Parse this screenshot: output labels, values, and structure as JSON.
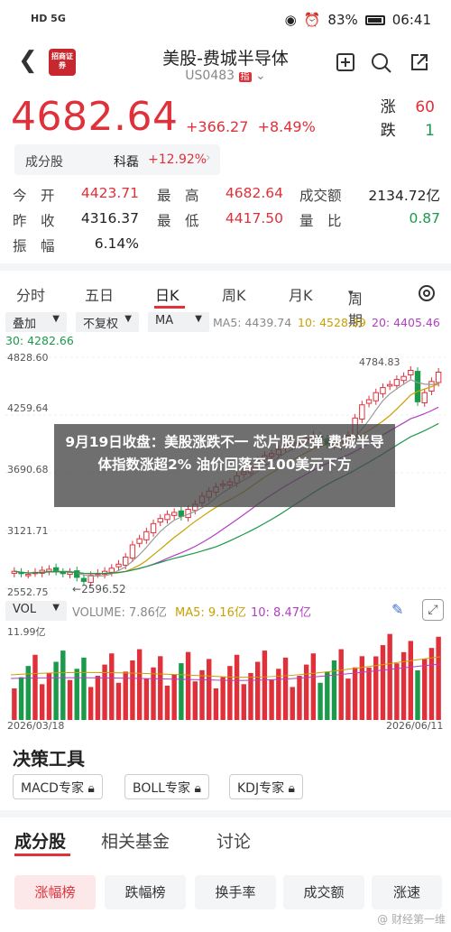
{
  "status": {
    "left": "HD 5G",
    "battery": "83%",
    "time": "06:41"
  },
  "header": {
    "logo_text": "招商证券",
    "title": "美股-费城半导体",
    "code": "US0483",
    "tag": "指"
  },
  "quote": {
    "price": "4682.64",
    "change": "+366.27",
    "pct": "+8.49%",
    "up_label": "涨",
    "up_count": "60",
    "down_label": "跌",
    "down_count": "1"
  },
  "sector": {
    "label": "成分股",
    "name": "科磊",
    "pct": "+12.92%"
  },
  "stats": [
    [
      {
        "k": "今　开",
        "v": "4423.71",
        "c": "red"
      },
      {
        "k": "最　高",
        "v": "4682.64",
        "c": "red"
      },
      {
        "k": "成交额",
        "v": "2134.72亿",
        "c": "dark"
      }
    ],
    [
      {
        "k": "昨　收",
        "v": "4316.37",
        "c": "dark"
      },
      {
        "k": "最　低",
        "v": "4417.50",
        "c": "red"
      },
      {
        "k": "量　比",
        "v": "0.87",
        "c": "green"
      }
    ],
    [
      {
        "k": "振　幅",
        "v": "6.14%",
        "c": "dark"
      }
    ]
  ],
  "tabs": [
    "分时",
    "五日",
    "日K",
    "周K",
    "月K",
    "周期"
  ],
  "controls": {
    "overlay": "叠加",
    "adjust": "不复权",
    "indicator": "MA"
  },
  "ma": {
    "ma5": "MA5: 4439.74",
    "ma10": "10: 4528.39",
    "ma20": "20: 4405.46",
    "ma30": "30: 4282.66"
  },
  "chart_data": {
    "type": "candlestick",
    "ylim": [
      2552.75,
      4828.6
    ],
    "y_ticks": [
      "4828.60",
      "4259.64",
      "3690.68",
      "3121.71",
      "2552.75"
    ],
    "annotations": {
      "high": "4784.83",
      "low": "2596.52"
    },
    "x_ticks": [
      "2026/03/18",
      "2026/06/11"
    ],
    "closes": [
      2720,
      2700,
      2690,
      2710,
      2730,
      2740,
      2720,
      2700,
      2710,
      2660,
      2620,
      2680,
      2700,
      2720,
      2750,
      2790,
      2860,
      2980,
      3040,
      3110,
      3190,
      3240,
      3280,
      3300,
      3260,
      3330,
      3380,
      3460,
      3510,
      3550,
      3580,
      3600,
      3660,
      3700,
      3750,
      3810,
      3860,
      3880,
      3920,
      3960,
      3990,
      4000,
      4030,
      4060,
      4010,
      3970,
      3960,
      3990,
      4060,
      4230,
      4360,
      4410,
      4480,
      4530,
      4560,
      4610,
      4640,
      4700,
      4390,
      4480,
      4590,
      4682
    ]
  },
  "volume": {
    "label": "VOL",
    "vol": "VOLUME: 7.86亿",
    "ma5": "MA5: 9.16亿",
    "ma10": "10: 8.47亿",
    "max": "11.99亿"
  },
  "decision": {
    "title": "决策工具",
    "chips": [
      "MACD专家",
      "BOLL专家",
      "KDJ专家"
    ]
  },
  "bottom_tabs": [
    "成分股",
    "相关基金",
    "讨论"
  ],
  "pills": [
    "涨幅榜",
    "跌幅榜",
    "换手率",
    "成交额",
    "涨速"
  ],
  "news": "9月19日收盘：美股涨跌不一 芯片股反弹 费城半导体指数涨超2% 油价回落至100美元下方",
  "watermark": "@ 财经第一维"
}
